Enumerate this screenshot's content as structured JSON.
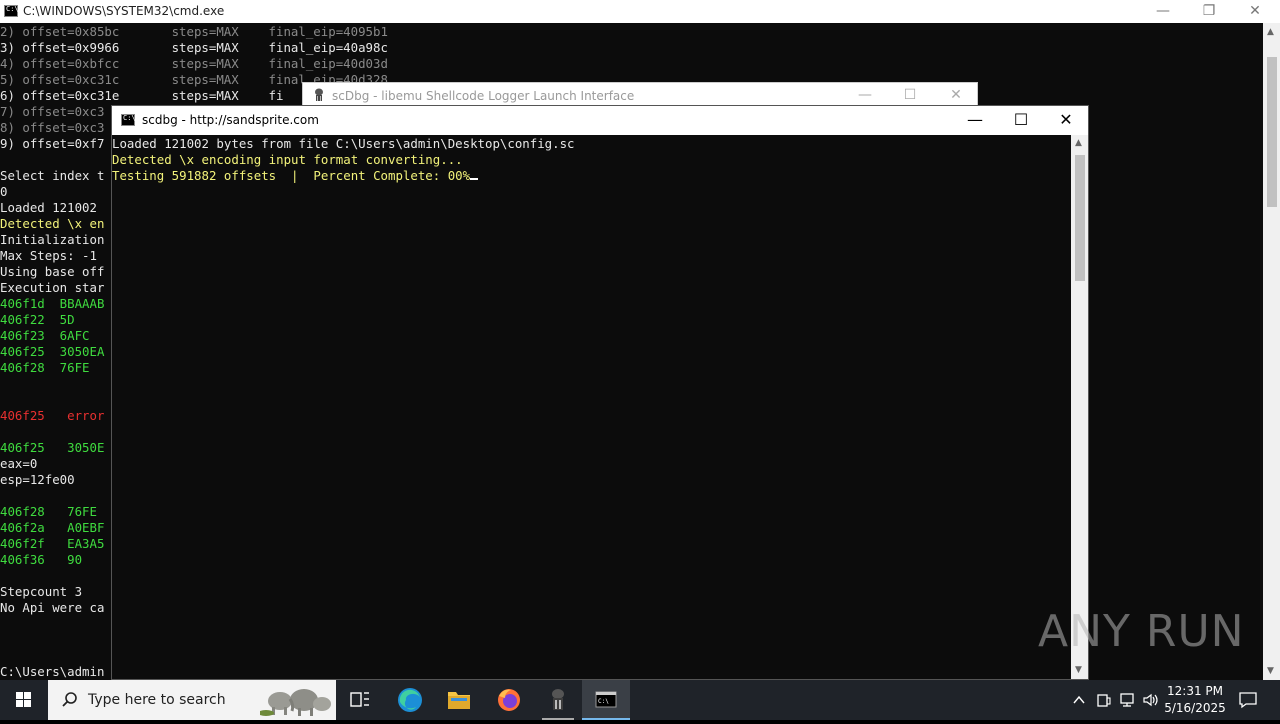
{
  "bg_window": {
    "title": "C:\\WINDOWS\\SYSTEM32\\cmd.exe",
    "lines": [
      {
        "t": "2) offset=0x85bc       steps=MAX    final_eip=4095b1",
        "c": "#8a8a8a"
      },
      {
        "t": "3) offset=0x9966       steps=MAX    final_eip=40a98c",
        "c": "#e8e8e8"
      },
      {
        "t": "4) offset=0xbfcc       steps=MAX    final_eip=40d03d",
        "c": "#8a8a8a"
      },
      {
        "t": "5) offset=0xc31c       steps=MAX    final_eip=40d328",
        "c": "#8a8a8a"
      },
      {
        "t": "6) offset=0xc31e       steps=MAX    fi",
        "c": "#e8e8e8"
      },
      {
        "t": "7) offset=0xc3",
        "c": "#8a8a8a"
      },
      {
        "t": "8) offset=0xc3",
        "c": "#8a8a8a"
      },
      {
        "t": "9) offset=0xf7",
        "c": "#e8e8e8"
      },
      {
        "t": "",
        "c": "#e8e8e8"
      },
      {
        "t": "Select index t",
        "c": "#e8e8e8"
      },
      {
        "t": "0",
        "c": "#e8e8e8"
      },
      {
        "t": "Loaded 121002",
        "c": "#e8e8e8"
      },
      {
        "t": "Detected \\x en",
        "c": "#f2f27a"
      },
      {
        "t": "Initialization",
        "c": "#e8e8e8"
      },
      {
        "t": "Max Steps: -1",
        "c": "#e8e8e8"
      },
      {
        "t": "Using base off",
        "c": "#e8e8e8"
      },
      {
        "t": "Execution star",
        "c": "#e8e8e8"
      },
      {
        "t": "406f1d  BBAAAB",
        "c": "#3fdc3f"
      },
      {
        "t": "406f22  5D",
        "c": "#3fdc3f"
      },
      {
        "t": "406f23  6AFC",
        "c": "#3fdc3f"
      },
      {
        "t": "406f25  3050EA",
        "c": "#3fdc3f"
      },
      {
        "t": "406f28  76FE",
        "c": "#3fdc3f"
      },
      {
        "t": "",
        "c": "#e8e8e8"
      },
      {
        "t": "",
        "c": "#e8e8e8"
      },
      {
        "t": "406f25   error",
        "c": "#e83030"
      },
      {
        "t": "",
        "c": "#e8e8e8"
      },
      {
        "t": "406f25   3050E",
        "c": "#3fdc3f"
      },
      {
        "t": "eax=0",
        "c": "#e8e8e8"
      },
      {
        "t": "esp=12fe00",
        "c": "#e8e8e8"
      },
      {
        "t": "",
        "c": "#e8e8e8"
      },
      {
        "t": "406f28   76FE",
        "c": "#3fdc3f"
      },
      {
        "t": "406f2a   A0EBF",
        "c": "#3fdc3f"
      },
      {
        "t": "406f2f   EA3A5",
        "c": "#3fdc3f"
      },
      {
        "t": "406f36   90",
        "c": "#3fdc3f"
      },
      {
        "t": "",
        "c": "#e8e8e8"
      },
      {
        "t": "Stepcount 3",
        "c": "#e8e8e8"
      },
      {
        "t": "No Api were ca",
        "c": "#e8e8e8"
      },
      {
        "t": "",
        "c": "#e8e8e8"
      },
      {
        "t": "",
        "c": "#e8e8e8"
      },
      {
        "t": "",
        "c": "#e8e8e8"
      },
      {
        "t": "C:\\Users\\admin",
        "c": "#e8e8e8"
      }
    ]
  },
  "mid_window": {
    "title": "scDbg - libemu Shellcode Logger Launch Interface"
  },
  "front_window": {
    "title": "scdbg - http://sandsprite.com",
    "lines": [
      {
        "t": "Loaded 121002 bytes from file C:\\Users\\admin\\Desktop\\config.sc",
        "c": "#e8e8e8"
      },
      {
        "t": "Detected \\x encoding input format converting...",
        "c": "#f2f27a"
      },
      {
        "t": "Testing 591882 offsets  |  Percent Complete: 00%",
        "c": "#f2f27a"
      }
    ]
  },
  "watermark": "ANY RUN",
  "taskbar": {
    "search_placeholder": "Type here to search",
    "time": "12:31 PM",
    "date": "5/16/2025"
  }
}
